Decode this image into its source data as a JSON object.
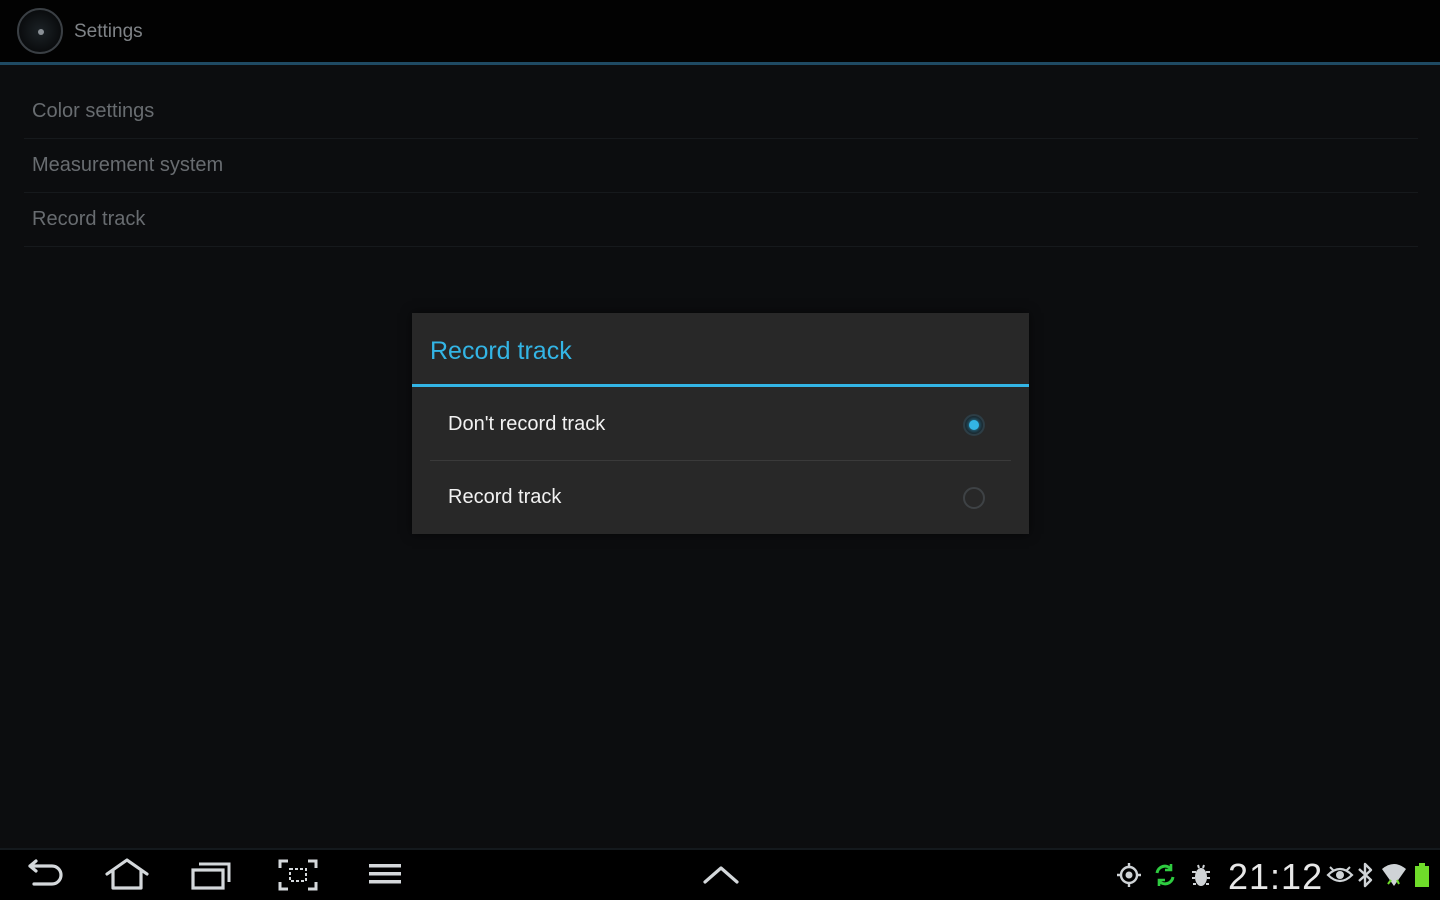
{
  "action_bar": {
    "title": "Settings",
    "app_icon": "app-gauge-icon"
  },
  "preferences": [
    {
      "label": "Color settings"
    },
    {
      "label": "Measurement system"
    },
    {
      "label": "Record track"
    }
  ],
  "dialog": {
    "title": "Record track",
    "options": [
      {
        "label": "Don't record track",
        "selected": true
      },
      {
        "label": "Record track",
        "selected": false
      }
    ]
  },
  "system_bar": {
    "nav_icons": [
      "back-icon",
      "home-icon",
      "recent-apps-icon",
      "screenshot-icon",
      "menu-icon",
      "up-arrow-icon"
    ],
    "status_icons": [
      "gps-icon",
      "sync-icon",
      "usb-debug-icon",
      "eye-icon",
      "bluetooth-icon",
      "wifi-icon",
      "battery-icon"
    ],
    "clock": "21:12"
  },
  "colors": {
    "accent": "#33b5e5",
    "background": "#0c0d0f",
    "dialog_background": "#282828",
    "sync_green": "#2ecc40",
    "battery_green": "#6fdc2a"
  }
}
